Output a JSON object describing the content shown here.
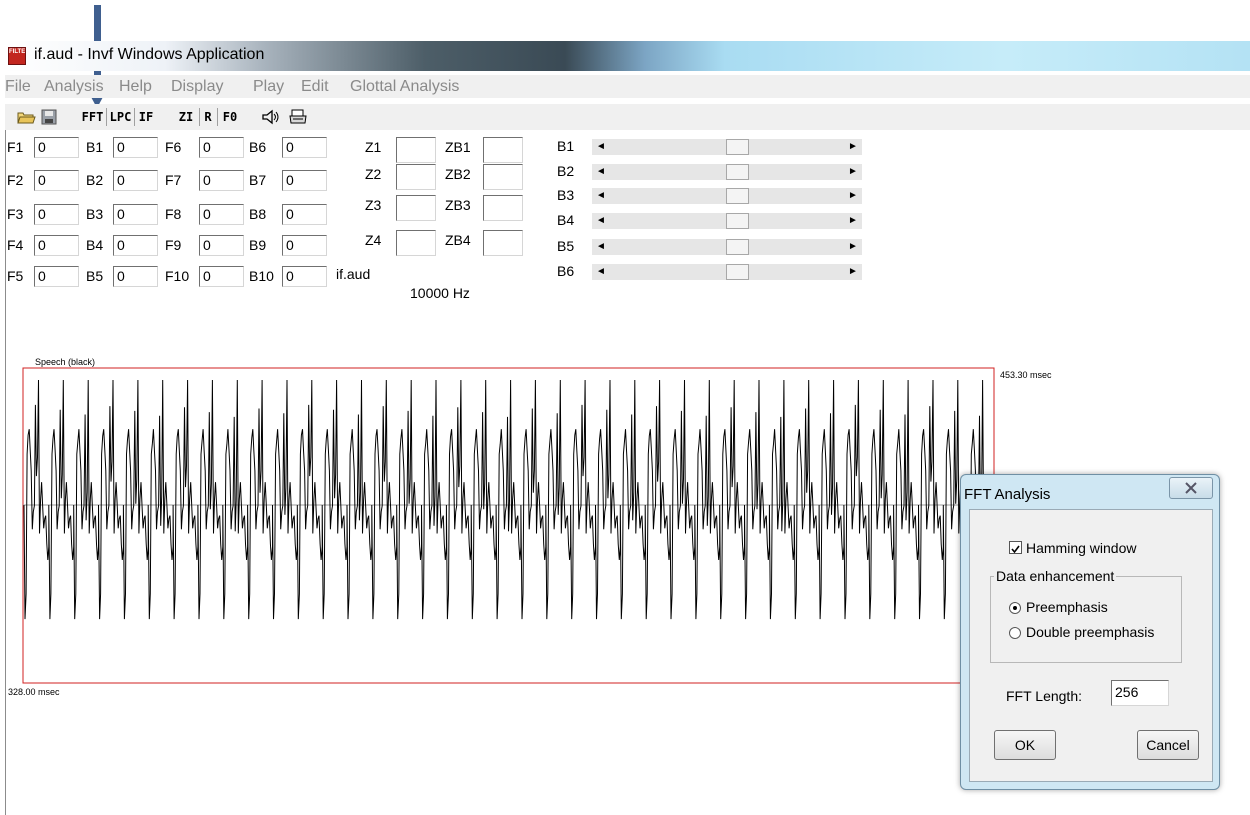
{
  "window": {
    "title": "if.aud - Invf Windows Application",
    "icon": "filter-app-icon"
  },
  "menu": [
    "File",
    "Analysis",
    "Help",
    "Display",
    "Play",
    "Edit",
    "Glottal Analysis"
  ],
  "toolbar": {
    "buttons": [
      "FFT",
      "LPC",
      "IF",
      "ZI",
      "R",
      "F0"
    ],
    "icons": [
      "open-folder-icon",
      "save-disk-icon",
      "speaker-icon",
      "printer-icon"
    ]
  },
  "formants": {
    "rows": [
      {
        "f": "F1",
        "fv": "0",
        "b": "B1",
        "bv": "0",
        "f2": "F6",
        "f2v": "0",
        "b2": "B6",
        "b2v": "0"
      },
      {
        "f": "F2",
        "fv": "0",
        "b": "B2",
        "bv": "0",
        "f2": "F7",
        "f2v": "0",
        "b2": "B7",
        "b2v": "0"
      },
      {
        "f": "F3",
        "fv": "0",
        "b": "B3",
        "bv": "0",
        "f2": "F8",
        "f2v": "0",
        "b2": "B8",
        "b2v": "0"
      },
      {
        "f": "F4",
        "fv": "0",
        "b": "B4",
        "bv": "0",
        "f2": "F9",
        "f2v": "0",
        "b2": "B9",
        "b2v": "0"
      },
      {
        "f": "F5",
        "fv": "0",
        "b": "B5",
        "bv": "0",
        "f2": "F10",
        "f2v": "0",
        "b2": "B10",
        "b2v": "0"
      }
    ]
  },
  "zeros": [
    {
      "z": "Z1",
      "zb": "ZB1"
    },
    {
      "z": "Z2",
      "zb": "ZB2"
    },
    {
      "z": "Z3",
      "zb": "ZB3"
    },
    {
      "z": "Z4",
      "zb": "ZB4"
    }
  ],
  "file_label": "if.aud",
  "sample_rate": "10000 Hz",
  "scrollbars": [
    "B1",
    "B2",
    "B3",
    "B4",
    "B5",
    "B6"
  ],
  "plot": {
    "title": "Speech (black)",
    "start_time": "328.00 msec",
    "end_time": "453.30 msec",
    "cycles": 39,
    "frame_color": "#d02020",
    "axis_color": "#999999"
  },
  "dialog": {
    "title": "FFT Analysis",
    "hamming_label": "Hamming window",
    "hamming_checked": true,
    "group_label": "Data enhancement",
    "options": [
      "Preemphasis",
      "Double preemphasis"
    ],
    "selected_option": "Preemphasis",
    "fft_length_label": "FFT Length:",
    "fft_length": "256",
    "ok_label": "OK",
    "cancel_label": "Cancel"
  },
  "annotation_color": "#3f5f8f"
}
